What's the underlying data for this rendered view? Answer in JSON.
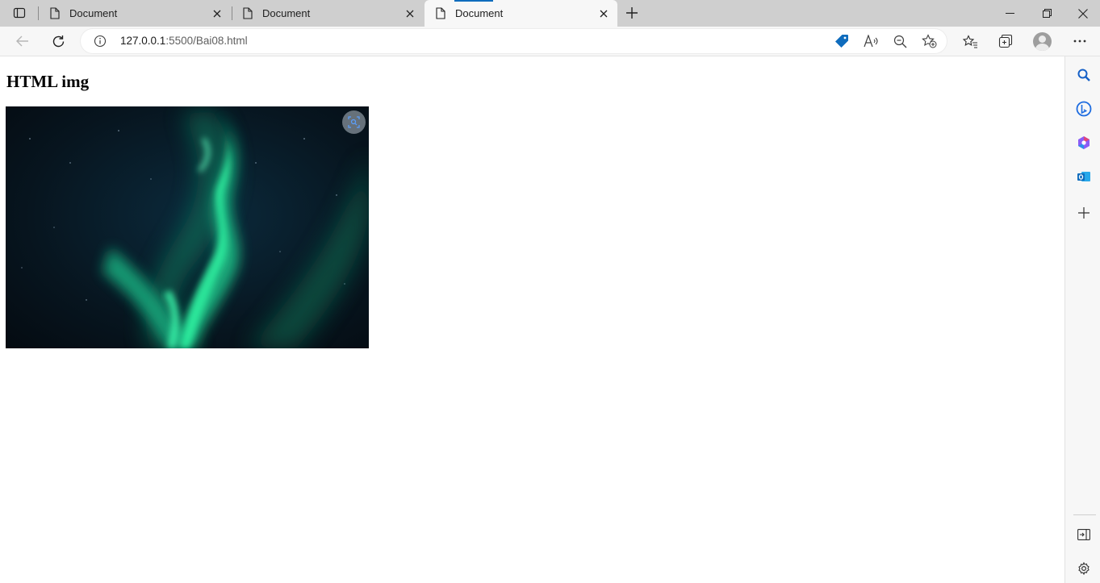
{
  "tabs": [
    {
      "title": "Document",
      "active": false
    },
    {
      "title": "Document",
      "active": false
    },
    {
      "title": "Document",
      "active": true
    }
  ],
  "address": {
    "host": "127.0.0.1",
    "path": ":5500/Bai08.html"
  },
  "page": {
    "heading": "HTML img"
  },
  "colors": {
    "accent": "#0f6cbd",
    "tabstrip": "#cfcfcf",
    "toolbar": "#f7f7f7",
    "aurora_green": "#1ee38c"
  },
  "icons": {
    "tab_actions": "tab-actions-icon",
    "page": "document-icon",
    "close": "close-icon",
    "new_tab": "plus-icon",
    "back": "back-arrow-icon",
    "refresh": "refresh-icon",
    "info": "info-icon",
    "shopping": "shopping-tag-icon",
    "read_aloud": "read-aloud-icon",
    "zoom_out": "zoom-out-icon",
    "add_favorite": "add-favorite-icon",
    "favorites": "favorites-icon",
    "collections": "collections-icon",
    "profile": "avatar-icon",
    "more": "more-icon",
    "search": "search-icon",
    "bing": "bing-icon",
    "office": "office-icon",
    "outlook": "outlook-icon",
    "add_sidebar": "plus-icon",
    "hide_sidebar": "hide-sidebar-icon",
    "settings": "gear-icon",
    "visual_search": "visual-search-icon"
  }
}
